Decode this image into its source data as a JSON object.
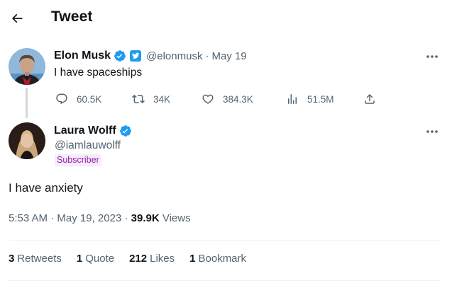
{
  "header": {
    "title": "Tweet",
    "back_icon": "arrow-left-icon"
  },
  "parent_tweet": {
    "display_name": "Elon Musk",
    "verified_badge": "blue-check-icon",
    "twitter_blue_badge": "twitter-blue-icon",
    "handle": "@elonmusk",
    "separator": "·",
    "date": "May 19",
    "text": "I have spaceships",
    "actions": {
      "replies": "60.5K",
      "retweets": "34K",
      "likes": "384.3K",
      "views": "51.5M"
    },
    "more_icon": "more-horizontal-icon"
  },
  "reply_tweet": {
    "display_name": "Laura Wolff",
    "verified_badge": "blue-check-icon",
    "handle": "@iamlauwolff",
    "subscriber_label": "Subscriber",
    "text": "I have anxiety",
    "time": "5:53 AM",
    "separator": "·",
    "date": "May 19, 2023",
    "views_count": "39.9K",
    "views_label": "Views",
    "more_icon": "more-horizontal-icon"
  },
  "stats": [
    {
      "num": "3",
      "label": "Retweets"
    },
    {
      "num": "1",
      "label": "Quote"
    },
    {
      "num": "212",
      "label": "Likes"
    },
    {
      "num": "1",
      "label": "Bookmark"
    }
  ],
  "colors": {
    "text_primary": "#0f1419",
    "text_secondary": "#536471",
    "verified_blue": "#1d9bf0",
    "divider": "#eff3f4",
    "subscriber_bg": "#f7ecfa",
    "subscriber_text": "#8b1fa8"
  }
}
